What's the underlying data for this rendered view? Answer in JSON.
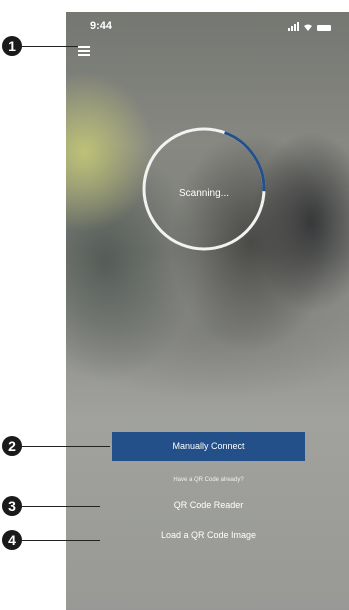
{
  "status_bar": {
    "time": "9:44",
    "icons": [
      "signal-icon",
      "wifi-icon",
      "battery-icon"
    ]
  },
  "menu": {
    "icon": "menu-icon"
  },
  "scanner": {
    "label": "Scanning...",
    "progress": 0.2,
    "ring_color": "#f2f2f2",
    "progress_color": "#24508a"
  },
  "actions": {
    "manual_connect_label": "Manually Connect",
    "qr_prompt": "Have a QR Code already?",
    "qr_reader_label": "QR Code Reader",
    "load_qr_image_label": "Load a QR Code Image"
  },
  "callouts": [
    {
      "number": "1"
    },
    {
      "number": "2"
    },
    {
      "number": "3"
    },
    {
      "number": "4"
    }
  ],
  "colors": {
    "accent": "#24508a",
    "callout": "#1a1a1a"
  }
}
